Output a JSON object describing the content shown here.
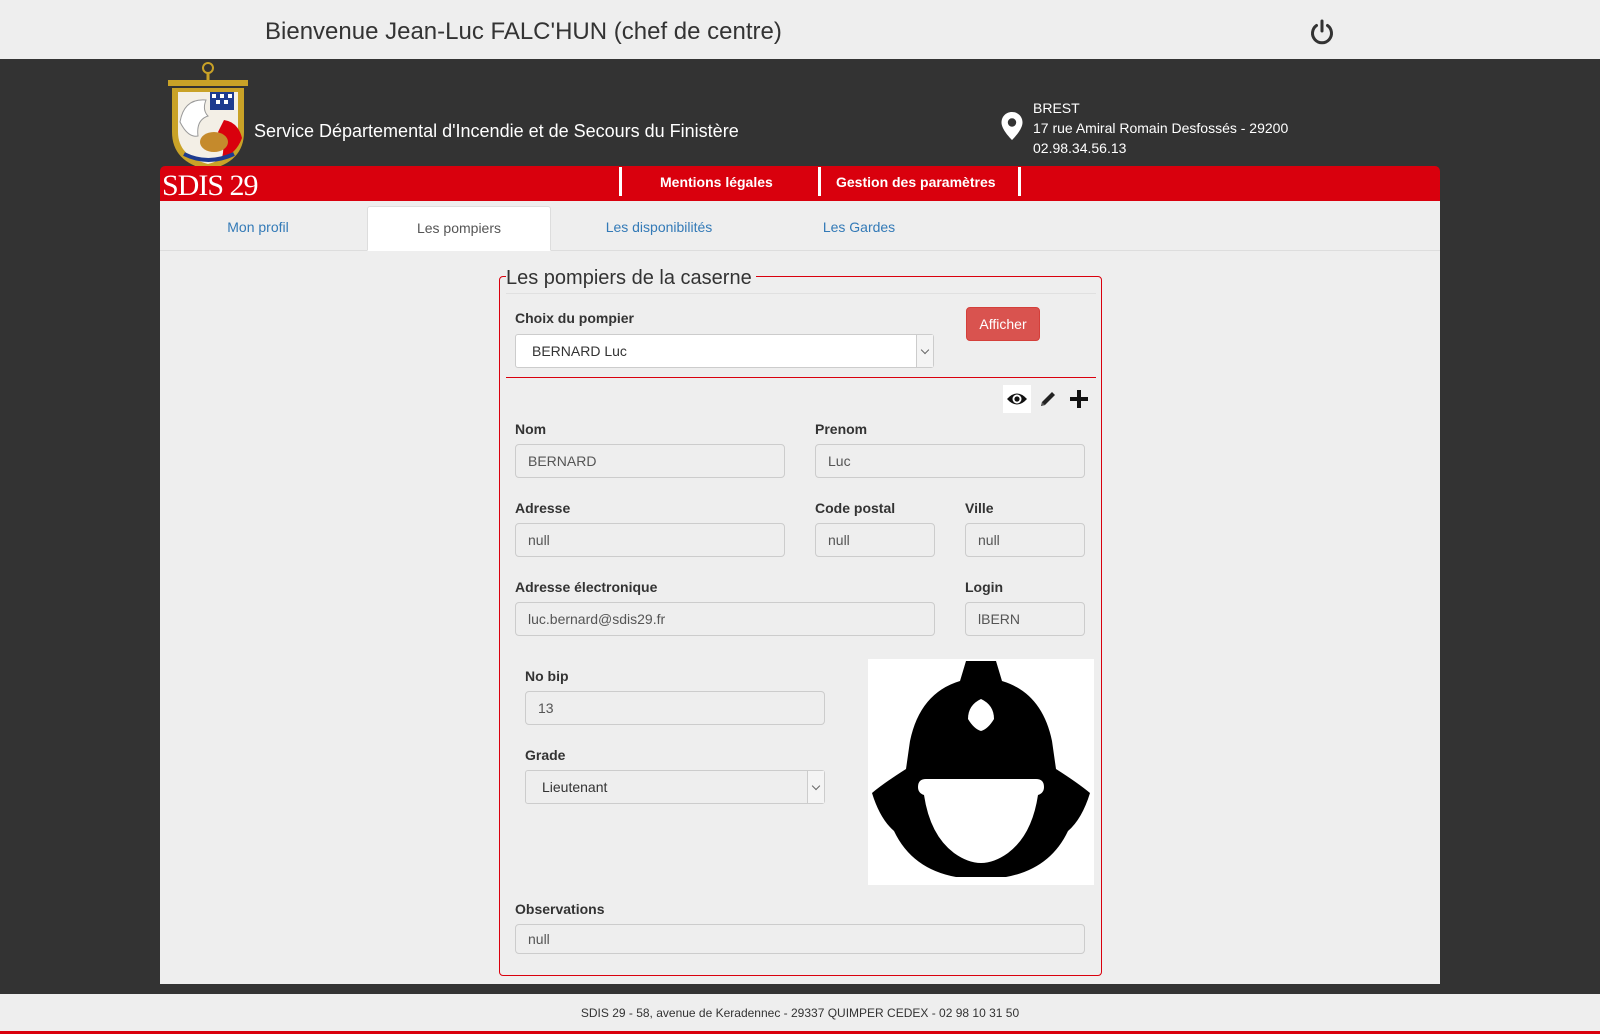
{
  "header": {
    "welcome": "Bienvenue Jean-Luc FALC'HUN (chef de centre)",
    "org_name": "Service Départemental d'Incendie et de Secours du Finistère",
    "logo_text": "SDIS 29",
    "address": {
      "city": "BREST",
      "street": "17 rue Amiral Romain Desfossés - 29200",
      "phone": "02.98.34.56.13"
    }
  },
  "menu": {
    "items": [
      {
        "label": "Mentions légales"
      },
      {
        "label": "Gestion des paramètres"
      }
    ]
  },
  "tabs": [
    {
      "label": "Mon profil",
      "active": false
    },
    {
      "label": "Les pompiers",
      "active": true
    },
    {
      "label": "Les disponibilités",
      "active": false
    },
    {
      "label": "Les Gardes",
      "active": false
    }
  ],
  "panel": {
    "title": "Les pompiers de la caserne",
    "choice_label": "Choix du pompier",
    "choice_value": "BERNARD Luc",
    "show_button": "Afficher"
  },
  "form": {
    "nom": {
      "label": "Nom",
      "value": "BERNARD"
    },
    "prenom": {
      "label": "Prenom",
      "value": "Luc"
    },
    "adresse": {
      "label": "Adresse",
      "value": "null"
    },
    "code_postal": {
      "label": "Code postal",
      "value": "null"
    },
    "ville": {
      "label": "Ville",
      "value": "null"
    },
    "email": {
      "label": "Adresse électronique",
      "value": "luc.bernard@sdis29.fr"
    },
    "login": {
      "label": "Login",
      "value": "lBERN"
    },
    "bip": {
      "label": "No bip",
      "value": "13"
    },
    "grade": {
      "label": "Grade",
      "value": "Lieutenant"
    },
    "observations": {
      "label": "Observations",
      "value": "null"
    }
  },
  "actions": {
    "view": "eye-icon",
    "edit": "pencil-icon",
    "add": "plus-icon"
  },
  "footer": {
    "text": "SDIS 29 - 58, avenue de Keradennec - 29337 QUIMPER CEDEX - 02 98 10 31 50"
  },
  "colors": {
    "brand_red": "#d9000d",
    "button_red": "#d9534f",
    "dark_bg": "#333333",
    "link": "#337ab7"
  }
}
